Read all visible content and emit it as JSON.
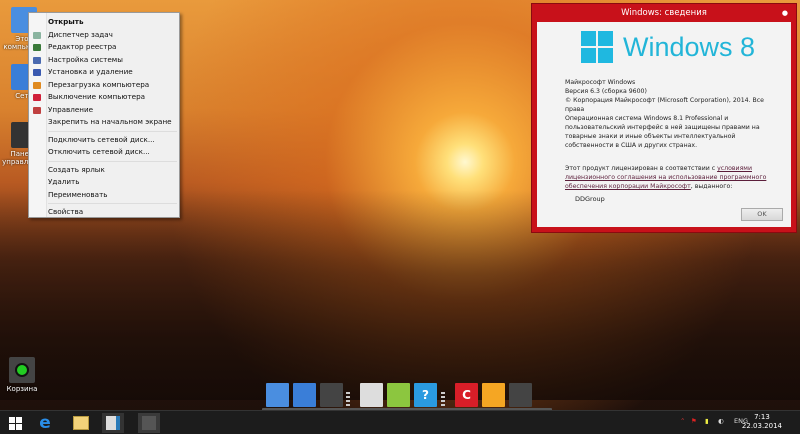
{
  "desktop": {
    "icons": [
      {
        "label": "Этот компьютер"
      },
      {
        "label": "Сеть"
      },
      {
        "label": "Панель управления"
      },
      {
        "label": "Корзина"
      }
    ]
  },
  "context_menu": {
    "items": [
      {
        "label": "Открыть",
        "bold": true,
        "icon": "none"
      },
      {
        "label": "Диспетчер задач",
        "icon": "task-manager-icon",
        "color": "#8ab4a0"
      },
      {
        "label": "Редактор реестра",
        "icon": "registry-icon",
        "color": "#3a7a3a"
      },
      {
        "label": "Настройка системы",
        "icon": "system-config-icon",
        "color": "#4a6ab0"
      },
      {
        "label": "Установка и удаление",
        "icon": "programs-icon",
        "color": "#3a5ab0"
      },
      {
        "label": "Перезагрузка компьютера",
        "icon": "restart-icon",
        "color": "#e08a20"
      },
      {
        "label": "Выключение компьютера",
        "icon": "shutdown-icon",
        "color": "#d0203a"
      },
      {
        "label": "Управление",
        "icon": "manage-icon",
        "color": "#c04040"
      },
      {
        "label": "Закрепить на начальном экране",
        "icon": "none"
      },
      {
        "label": "Подключить сетевой диск...",
        "icon": "none",
        "sep_before": true
      },
      {
        "label": "Отключить сетевой диск...",
        "icon": "none"
      },
      {
        "label": "Создать ярлык",
        "icon": "none",
        "sep_before": true
      },
      {
        "label": "Удалить",
        "icon": "none"
      },
      {
        "label": "Переименовать",
        "icon": "none"
      },
      {
        "label": "Свойства",
        "icon": "none",
        "sep_before": true
      }
    ]
  },
  "about_dialog": {
    "title": "Windows: сведения",
    "logo_text": "Windows 8",
    "lines": [
      "Майкрософт Windows",
      "Версия 6.3 (сборка 9600)",
      "© Корпорация Майкрософт (Microsoft Corporation), 2014. Все права",
      "Операционная система Windows 8.1 Professional и пользовательский интерфейс в ней защищены правами на товарные знаки и иные объекты интеллектуальной собственности в США и других странах."
    ],
    "license_prefix": "Этот продукт лицензирован в соответствии с ",
    "license_link": "условиями лицензионного соглашения на использование программного обеспечения корпорации Майкрософт",
    "license_suffix": ", выданного:",
    "owner": "DDGroup",
    "ok_label": "OK",
    "accent": "#c8111a"
  },
  "dock": {
    "items": [
      {
        "icon": "computer-icon",
        "color": "#4a8ee0"
      },
      {
        "icon": "globe-icon",
        "color": "#3a7ed8"
      },
      {
        "icon": "control-panel-icon",
        "color": "#444"
      },
      {
        "icon": "gamepad-icon",
        "color": "#ddd"
      },
      {
        "icon": "share-icon",
        "color": "#8cc63f"
      },
      {
        "icon": "help-icon",
        "color": "#2a9ae0",
        "text": "?"
      },
      {
        "icon": "ccleaner-icon",
        "color": "#d81e28",
        "text": "C"
      },
      {
        "icon": "folder-icon",
        "color": "#f5a623"
      },
      {
        "icon": "recycle-bin-icon",
        "color": "#444"
      }
    ]
  },
  "taskbar": {
    "language": "ENG",
    "time": "7:13",
    "date": "22.03.2014"
  }
}
